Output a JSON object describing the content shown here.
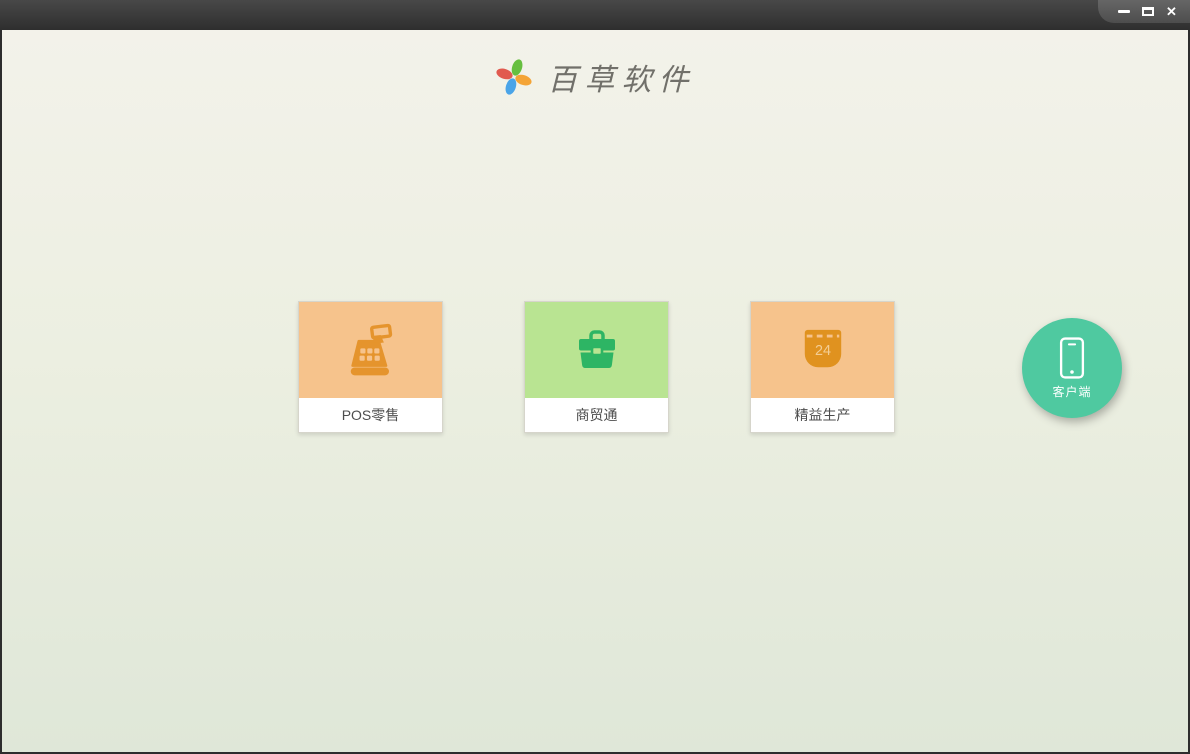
{
  "window": {
    "controls": [
      {
        "name": "minimize"
      },
      {
        "name": "maximize"
      },
      {
        "name": "close",
        "glyph": "✕"
      }
    ]
  },
  "header": {
    "logo": "pinwheel-logo",
    "title": "百草软件"
  },
  "products": [
    {
      "label": "POS零售",
      "icon": "cash-register-icon"
    },
    {
      "label": "商贸通",
      "icon": "briefcase-icon"
    },
    {
      "label": "精益生产",
      "icon": "calendar-icon",
      "calendar_day": "24"
    }
  ],
  "client_button": {
    "label": "客户端",
    "icon": "smartphone-icon"
  },
  "colors": {
    "card_orange_bg": "#f6c38c",
    "card_green_bg": "#b9e492",
    "icon_register_orange": "#e5942d",
    "icon_briefcase_green": "#2db564",
    "icon_calendar_orange": "#e0921f",
    "client_teal": "#4fc9a0",
    "titlebar_dark": "#3a3a3a",
    "logo_green": "#66bf3f",
    "logo_orange": "#f4a436",
    "logo_blue": "#4aa4e8",
    "logo_red": "#e15a4f"
  }
}
